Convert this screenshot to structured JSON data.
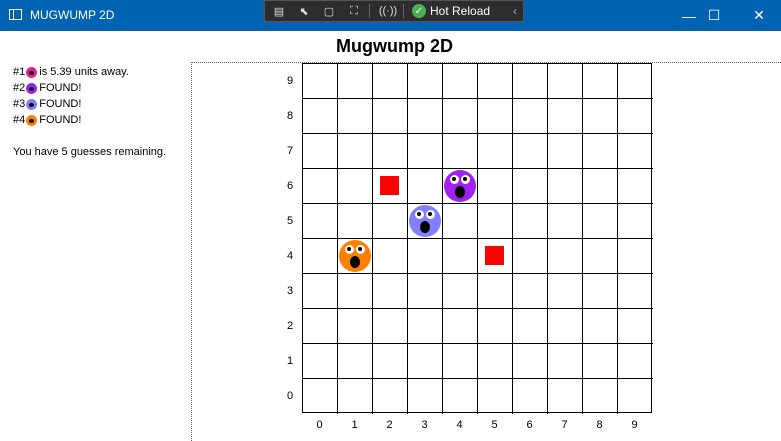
{
  "window": {
    "title": "MUGWUMP 2D",
    "minimize": "—",
    "maximize": "☐",
    "close": "✕"
  },
  "devbar": {
    "hot_reload_label": "Hot Reload"
  },
  "game": {
    "title": "Mugwump 2D"
  },
  "status": {
    "mugwumps": [
      {
        "prefix": "#1",
        "text": "is 5.39 units away.",
        "color": "#e0228a"
      },
      {
        "prefix": "#2",
        "text": "FOUND!",
        "color": "#a020f0"
      },
      {
        "prefix": "#3",
        "text": "FOUND!",
        "color": "#8080ff"
      },
      {
        "prefix": "#4",
        "text": "FOUND!",
        "color": "#ff8000"
      }
    ],
    "guesses_text": "You have 5 guesses remaining."
  },
  "grid": {
    "x_labels": [
      "0",
      "1",
      "2",
      "3",
      "4",
      "5",
      "6",
      "7",
      "8",
      "9"
    ],
    "y_labels": [
      "0",
      "1",
      "2",
      "3",
      "4",
      "5",
      "6",
      "7",
      "8",
      "9"
    ],
    "missed_guesses": [
      {
        "x": 2,
        "y": 6
      },
      {
        "x": 5,
        "y": 4
      }
    ],
    "found_mugwumps": [
      {
        "id": 2,
        "x": 4,
        "y": 6,
        "color": "#a020f0"
      },
      {
        "id": 3,
        "x": 3,
        "y": 5,
        "color": "#8080ff"
      },
      {
        "id": 4,
        "x": 1,
        "y": 4,
        "color": "#ff8000"
      }
    ]
  }
}
